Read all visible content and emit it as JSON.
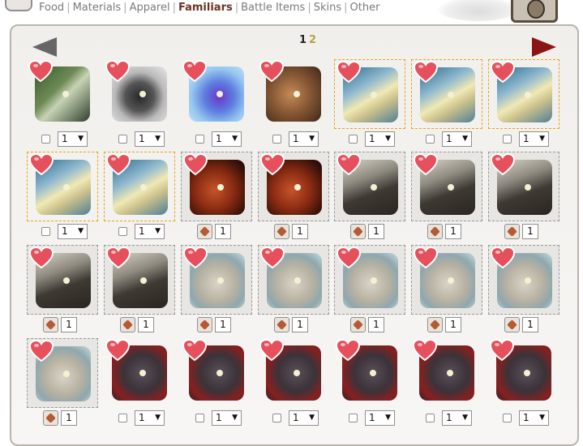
{
  "tabs": [
    {
      "label": "Food",
      "active": false
    },
    {
      "label": "Materials",
      "active": false
    },
    {
      "label": "Apparel",
      "active": false
    },
    {
      "label": "Familiars",
      "active": true
    },
    {
      "label": "Battle Items",
      "active": false
    },
    {
      "label": "Skins",
      "active": false
    },
    {
      "label": "Other",
      "active": false
    }
  ],
  "pagination": {
    "current": "1",
    "next": "2"
  },
  "items": [
    {
      "name": "familiar-moth",
      "art": "fam-moth",
      "border": "none",
      "control": "select",
      "qty": "1"
    },
    {
      "name": "familiar-hedgehog",
      "art": "fam-hedgehog",
      "border": "none",
      "control": "select",
      "qty": "1"
    },
    {
      "name": "familiar-dragonfly",
      "art": "fam-dragonfly",
      "border": "none",
      "control": "select",
      "qty": "1"
    },
    {
      "name": "familiar-mouse",
      "art": "fam-mouse",
      "border": "none",
      "control": "select",
      "qty": "1"
    },
    {
      "name": "familiar-serpent",
      "art": "fam-serpent",
      "border": "orange",
      "control": "select",
      "qty": "1"
    },
    {
      "name": "familiar-serpent",
      "art": "fam-serpent",
      "border": "orange",
      "control": "select",
      "qty": "1"
    },
    {
      "name": "familiar-serpent",
      "art": "fam-serpent",
      "border": "orange",
      "control": "select",
      "qty": "1"
    },
    {
      "name": "familiar-serpent",
      "art": "fam-serpent",
      "border": "orange",
      "control": "select",
      "qty": "1"
    },
    {
      "name": "familiar-serpent",
      "art": "fam-serpent",
      "border": "orange",
      "control": "select",
      "qty": "1"
    },
    {
      "name": "familiar-fire-bear",
      "art": "fam-bear",
      "border": "gray",
      "control": "bonus",
      "qty": "1"
    },
    {
      "name": "familiar-fire-bear",
      "art": "fam-bear",
      "border": "gray",
      "control": "bonus",
      "qty": "1"
    },
    {
      "name": "familiar-skull-beast",
      "art": "fam-skullbeast",
      "border": "gray",
      "control": "bonus",
      "qty": "1"
    },
    {
      "name": "familiar-skull-beast",
      "art": "fam-skullbeast",
      "border": "gray",
      "control": "bonus",
      "qty": "1"
    },
    {
      "name": "familiar-skull-beast",
      "art": "fam-skullbeast",
      "border": "gray",
      "control": "bonus",
      "qty": "1"
    },
    {
      "name": "familiar-skull-beast",
      "art": "fam-skullbeast",
      "border": "gray",
      "control": "bonus",
      "qty": "1"
    },
    {
      "name": "familiar-skull-beast",
      "art": "fam-skullbeast",
      "border": "gray",
      "control": "bonus",
      "qty": "1"
    },
    {
      "name": "familiar-stone-bear",
      "art": "fam-stonebear",
      "border": "gray",
      "control": "bonus",
      "qty": "1"
    },
    {
      "name": "familiar-stone-bear",
      "art": "fam-stonebear",
      "border": "gray",
      "control": "bonus",
      "qty": "1"
    },
    {
      "name": "familiar-stone-bear",
      "art": "fam-stonebear",
      "border": "gray",
      "control": "bonus",
      "qty": "1"
    },
    {
      "name": "familiar-stone-bear",
      "art": "fam-stonebear",
      "border": "gray",
      "control": "bonus",
      "qty": "1"
    },
    {
      "name": "familiar-stone-bear",
      "art": "fam-stonebear",
      "border": "gray",
      "control": "bonus",
      "qty": "1"
    },
    {
      "name": "familiar-stone-bear",
      "art": "fam-stonebear",
      "border": "gray",
      "control": "bonus",
      "qty": "1"
    },
    {
      "name": "familiar-turkey",
      "art": "fam-turkey",
      "border": "none",
      "control": "select",
      "qty": "1"
    },
    {
      "name": "familiar-turkey",
      "art": "fam-turkey",
      "border": "none",
      "control": "select",
      "qty": "1"
    },
    {
      "name": "familiar-turkey",
      "art": "fam-turkey",
      "border": "none",
      "control": "select",
      "qty": "1"
    },
    {
      "name": "familiar-turkey",
      "art": "fam-turkey",
      "border": "none",
      "control": "select",
      "qty": "1"
    },
    {
      "name": "familiar-turkey",
      "art": "fam-turkey",
      "border": "none",
      "control": "select",
      "qty": "1"
    },
    {
      "name": "familiar-turkey",
      "art": "fam-turkey",
      "border": "none",
      "control": "select",
      "qty": "1"
    }
  ],
  "colors": {
    "heart": "#e5505c",
    "heart_outline": "#ffffff",
    "active_tab": "#6b3322",
    "next_arrow": "#8b1414",
    "prev_arrow": "#666666"
  }
}
